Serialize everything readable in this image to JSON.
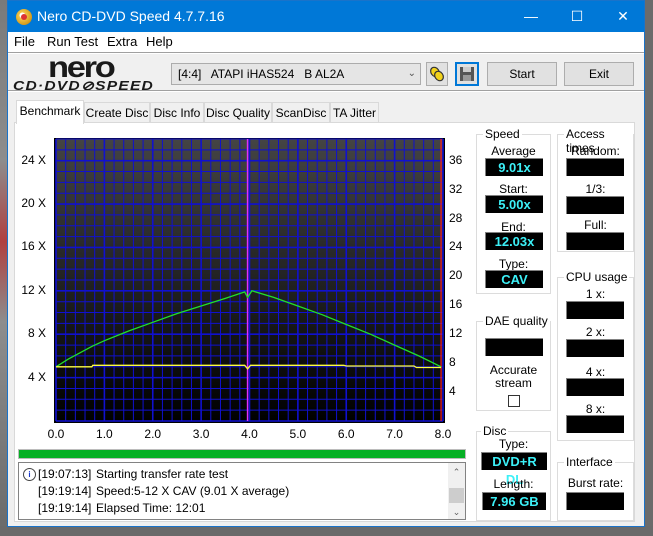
{
  "window": {
    "title": "Nero CD-DVD Speed 4.7.7.16",
    "controls": {
      "minimize": "—",
      "maximize": "☐",
      "close": "✕"
    }
  },
  "menu": [
    "File",
    "Run Test",
    "Extra",
    "Help"
  ],
  "logo": {
    "brand": "nero",
    "product": "CD·DVD⊘SPEED"
  },
  "toolbar": {
    "drive": "[4:4]   ATAPI iHAS524   B AL2A",
    "drive_dropdown_icon": "chevron-down-icon",
    "drive_info_icon": "chain-links-icon",
    "save_icon": "floppy-disk-icon",
    "start_label": "Start",
    "exit_label": "Exit"
  },
  "tabs": [
    {
      "label": "Benchmark",
      "active": true
    },
    {
      "label": "Create Disc",
      "active": false
    },
    {
      "label": "Disc Info",
      "active": false
    },
    {
      "label": "Disc Quality",
      "active": false
    },
    {
      "label": "ScanDisc",
      "active": false
    },
    {
      "label": "TA Jitter",
      "active": false
    }
  ],
  "chart_data": {
    "type": "line",
    "title": "",
    "xlabel": "",
    "ylabel": "",
    "x_ticks": [
      "0.0",
      "1.0",
      "2.0",
      "3.0",
      "4.0",
      "5.0",
      "6.0",
      "7.0",
      "8.0"
    ],
    "xlim": [
      0,
      8
    ],
    "y_left_ticks": [
      "4 X",
      "8 X",
      "12 X",
      "16 X",
      "20 X",
      "24 X"
    ],
    "ylim_left": [
      0,
      26
    ],
    "y_right_ticks": [
      "4",
      "8",
      "12",
      "16",
      "20",
      "24",
      "28",
      "32",
      "36"
    ],
    "ylim_right": [
      0,
      39
    ],
    "grid": true,
    "layer_break_x": 3.96,
    "end_marker_x": 7.96,
    "colors": {
      "transfer": "#22e02a",
      "rpm": "#ffff3c",
      "layer_break": "#e030ff",
      "end_marker": "#ff2020",
      "grid": "#1010d0"
    },
    "series": [
      {
        "name": "Transfer rate (X)",
        "axis": "left",
        "x": [
          0.0,
          0.25,
          0.5,
          0.75,
          1.0,
          1.5,
          2.0,
          2.5,
          3.0,
          3.5,
          3.9,
          3.96,
          4.05,
          4.5,
          5.0,
          5.5,
          6.0,
          6.5,
          7.0,
          7.5,
          7.96
        ],
        "y": [
          5.0,
          5.7,
          6.3,
          6.9,
          7.4,
          8.3,
          9.1,
          9.9,
          10.6,
          11.3,
          11.9,
          11.4,
          12.0,
          11.4,
          10.6,
          9.8,
          8.9,
          8.0,
          7.0,
          6.0,
          5.0
        ]
      },
      {
        "name": "Rotation (RPM scale)",
        "axis": "right",
        "x": [
          0.0,
          0.74,
          0.76,
          3.9,
          3.96,
          4.02,
          5.95,
          6.0,
          7.4,
          7.45,
          7.96
        ],
        "y": [
          7.5,
          7.5,
          7.7,
          7.7,
          7.2,
          7.7,
          7.7,
          7.6,
          7.6,
          7.4,
          7.4
        ]
      }
    ]
  },
  "progress": {
    "percent": 100,
    "color": "#06b025"
  },
  "log": {
    "entries": [
      {
        "time": "[19:07:13]",
        "message": "Starting transfer rate test",
        "icon": "info-icon"
      },
      {
        "time": "[19:19:14]",
        "message": "Speed:5-12 X CAV (9.01 X average)"
      },
      {
        "time": "[19:19:14]",
        "message": "Elapsed Time: 12:01"
      }
    ]
  },
  "speed": {
    "title": "Speed",
    "average_label": "Average",
    "average": "9.01x",
    "start_label": "Start:",
    "start": "5.00x",
    "end_label": "End:",
    "end": "12.03x",
    "type_label": "Type:",
    "type": "CAV"
  },
  "access_times": {
    "title": "Access times",
    "random_label": "Random:",
    "random": "",
    "third_label": "1/3:",
    "third": "",
    "full_label": "Full:",
    "full": ""
  },
  "cpu_usage": {
    "title": "CPU usage",
    "x1_label": "1 x:",
    "x2_label": "2 x:",
    "x4_label": "4 x:",
    "x8_label": "8 x:"
  },
  "dae_quality": {
    "title": "DAE quality",
    "value": "",
    "accurate_label": "Accurate\nstream",
    "accurate_stream": false
  },
  "disc": {
    "title": "Disc",
    "type_label": "Type:",
    "type": "DVD+R DL",
    "length_label": "Length:",
    "length": "7.96 GB"
  },
  "interface": {
    "title": "Interface",
    "burst_label": "Burst rate:",
    "burst": ""
  }
}
